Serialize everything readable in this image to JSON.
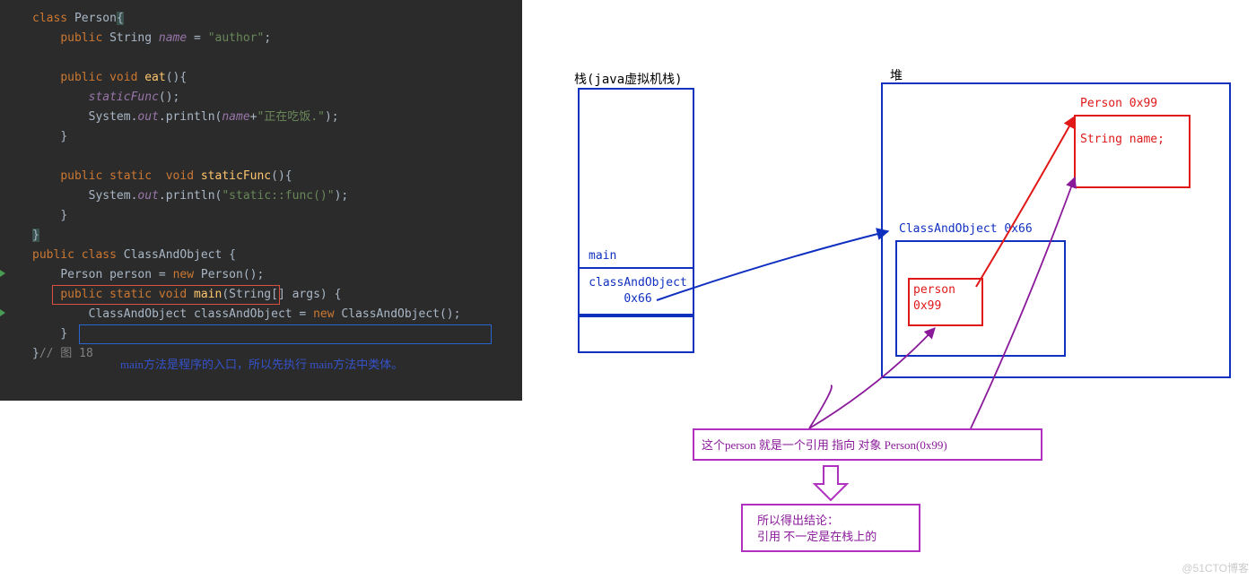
{
  "code": {
    "lines": {
      "l1_kw_class": "class",
      "l1_type": " Person",
      "l1_brace": "{",
      "l2_kw": "public",
      "l2_type": " String ",
      "l2_fld": "name",
      "l2_eq": " = ",
      "l2_str": "\"author\"",
      "l2_semi": ";",
      "l4_kw": "public void",
      "l4_fn": " eat",
      "l4_par": "(){",
      "l5_call": "staticFunc",
      "l5_par": "();",
      "l6a": "System.",
      "l6_out": "out",
      "l6b": ".println(",
      "l6_name": "name",
      "l6_plus": "+",
      "l6_str": "\"正在吃饭.\"",
      "l6_end": ");",
      "l7_brace": "}",
      "l9_kw": "public static  void",
      "l9_fn": " staticFunc",
      "l9_par": "(){",
      "l10a": "System.",
      "l10_out": "out",
      "l10b": ".println(",
      "l10_str": "\"static::func()\"",
      "l10_end": ");",
      "l11_brace": "}",
      "l12_brace": "}",
      "l13_kw": "public class",
      "l13_type": " ClassAndObject ",
      "l13_brace": "{",
      "l14_type": "Person ",
      "l14_var": "person",
      "l14_eq": " = ",
      "l14_new": "new",
      "l14_ctor": " Person();",
      "l15_kw": "public static void",
      "l15_fn": " main",
      "l15_par": "(String[] args) {",
      "l16_type": "ClassAndObject ",
      "l16_var": "classAndObject",
      "l16_eq": " = ",
      "l16_new": "new",
      "l16_ctor": " ClassAndObject();",
      "l17_brace": "}",
      "l18_brace": "}",
      "l18_cmt": "// 图 18"
    },
    "annotation": "main方法是程序的入口，所以先执行 main方法中类体。"
  },
  "diagram": {
    "stack_title": "栈(java虚拟机栈)",
    "heap_title": "堆",
    "stack": {
      "frame_label": "main",
      "var_name": "classAndObject",
      "var_addr": "0x66"
    },
    "heap": {
      "obj1_label": "ClassAndObject 0x66",
      "obj1_field": "person",
      "obj1_addr": "0x99",
      "obj2_label": "Person 0x99",
      "obj2_field": "String name;"
    },
    "note1": "这个person 就是一个引用 指向 对象 Person(0x99)",
    "note2_l1": "所以得出结论：",
    "note2_l2": "引用 不一定是在栈上的"
  },
  "watermark": "@51CTO博客"
}
